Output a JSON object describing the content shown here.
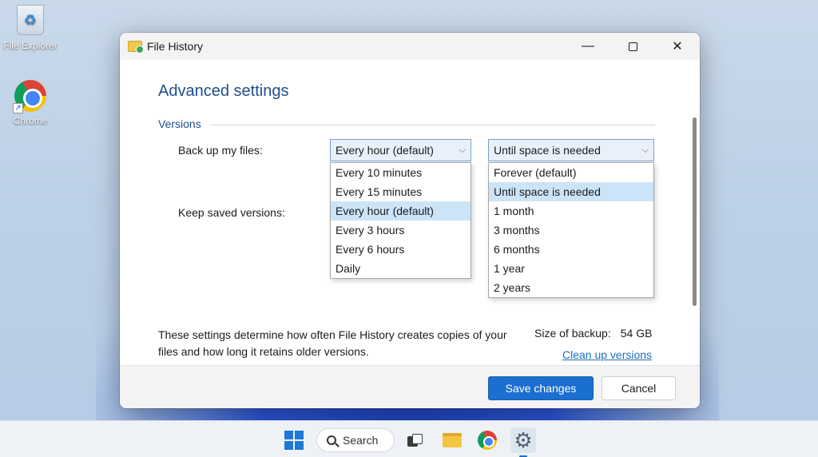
{
  "desktop": {
    "icons": [
      {
        "label": "File Explorer",
        "icon": "recycle-bin-icon"
      },
      {
        "label": "Chrome",
        "icon": "chrome-icon"
      }
    ]
  },
  "window": {
    "title": "File History",
    "heading": "Advanced settings",
    "group_label": "Versions",
    "backup_label": "Back up my files:",
    "keep_label": "Keep saved versions:",
    "frequency": {
      "selected": "Every hour (default)",
      "options": [
        "Every 10 minutes",
        "Every 15 minutes",
        "Every hour (default)",
        "Every 3 hours",
        "Every 6 hours",
        "Daily"
      ]
    },
    "retention": {
      "selected": "Until space is needed",
      "options": [
        "Forever (default)",
        "Until space is needed",
        "1 month",
        "3 months",
        "6 months",
        "1 year",
        "2 years"
      ]
    },
    "description": "These settings determine how often File History creates copies of your files and how long it retains older versions.",
    "size_label": "Size of backup:",
    "size_value": "54 GB",
    "cleanup_link": "Clean up versions",
    "save_label": "Save changes",
    "cancel_label": "Cancel"
  },
  "taskbar": {
    "search_label": "Search"
  }
}
